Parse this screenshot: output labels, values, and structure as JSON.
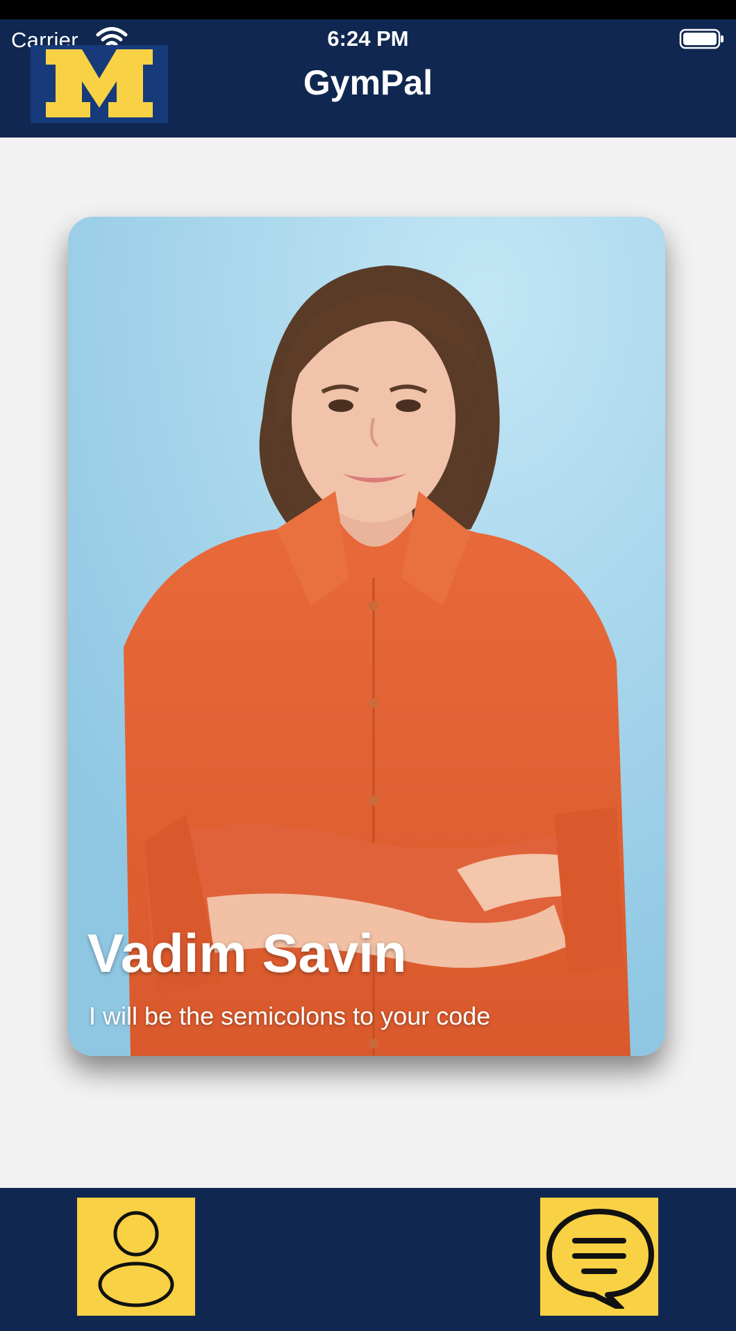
{
  "status_bar": {
    "carrier": "Carrier",
    "time": "6:24 PM"
  },
  "header": {
    "title": "GymPal",
    "logo_letter": "M",
    "logo_colors": {
      "background": "#163a7a",
      "letter": "#f8d144"
    }
  },
  "card": {
    "name": "Vadim Savin",
    "bio": "I will be the semicolons to your code"
  },
  "tabbar": {
    "left_icon": "profile-icon",
    "right_icon": "chat-icon"
  },
  "colors": {
    "navy": "#102851",
    "maize": "#f8d144",
    "background": "#f3f2f3"
  }
}
